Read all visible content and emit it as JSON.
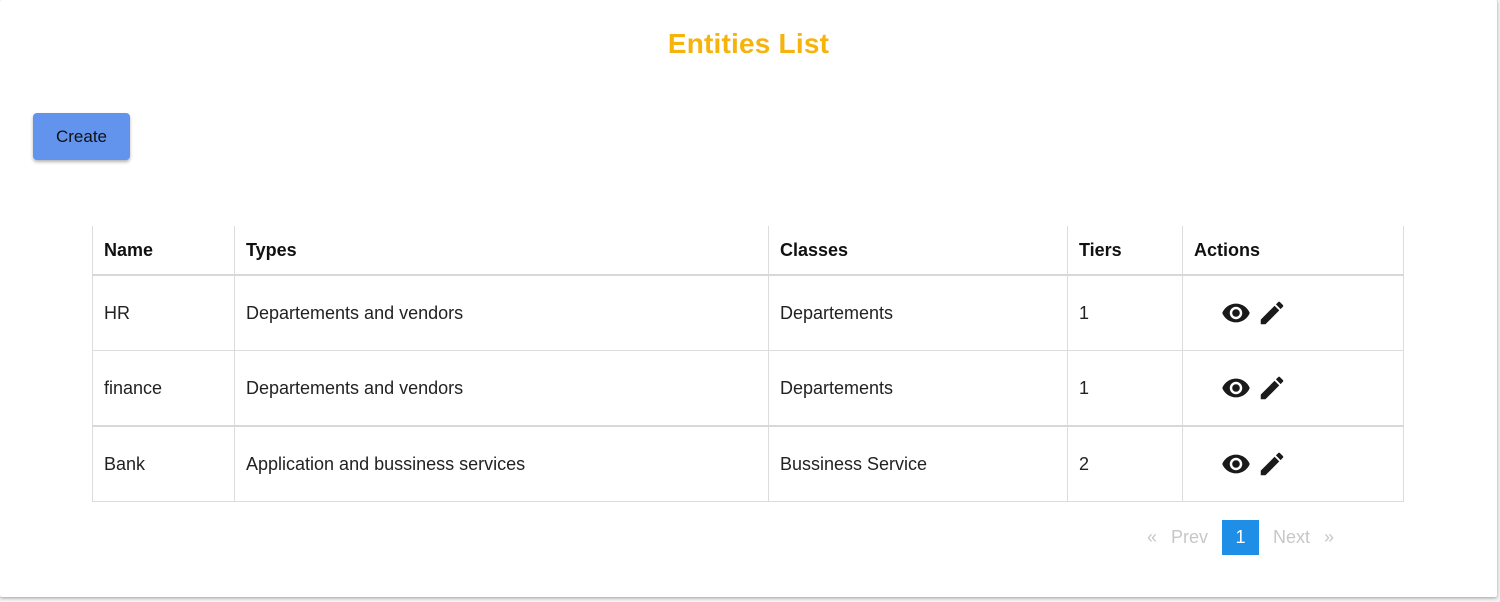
{
  "page": {
    "title": "Entities List",
    "title_color": "#f5b30c"
  },
  "toolbar": {
    "create_label": "Create",
    "create_color": "#6294ee"
  },
  "table": {
    "headers": {
      "name": "Name",
      "types": "Types",
      "classes": "Classes",
      "tiers": "Tiers",
      "actions": "Actions"
    },
    "rows": [
      {
        "name": "HR",
        "types": "Departements and vendors",
        "classes": "Departements",
        "tiers": "1",
        "actions": [
          "eye-icon",
          "pencil-icon"
        ]
      },
      {
        "name": "finance",
        "types": "Departements and vendors",
        "classes": "Departements",
        "tiers": "1",
        "actions": [
          "eye-icon",
          "pencil-icon"
        ]
      },
      {
        "name": "Bank",
        "types": "Application and bussiness services",
        "classes": "Bussiness Service",
        "tiers": "2",
        "actions": [
          "eye-icon",
          "pencil-icon"
        ]
      }
    ]
  },
  "pagination": {
    "first": "«",
    "prev": "Prev",
    "current": "1",
    "next": "Next",
    "last": "»",
    "active_color": "#1e8ee6"
  }
}
